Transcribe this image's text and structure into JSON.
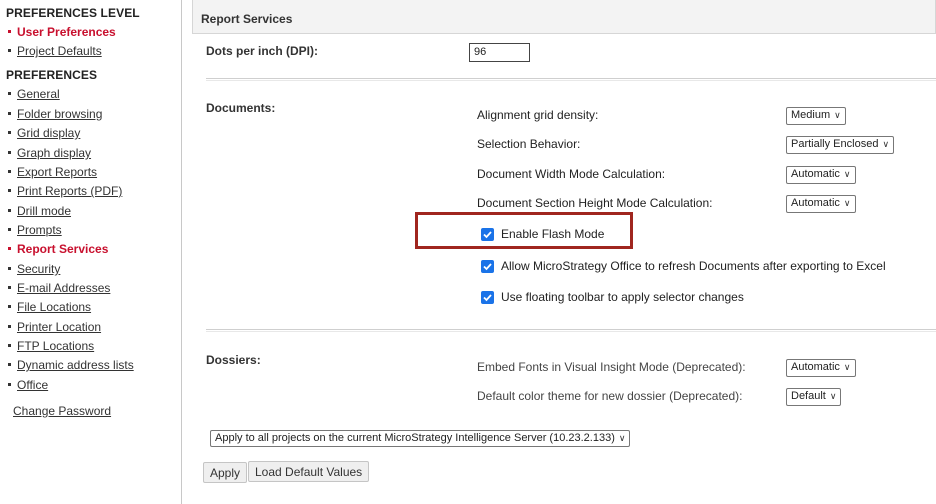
{
  "sidebar": {
    "section1_title": "PREFERENCES LEVEL",
    "level_items": [
      {
        "label": "User Preferences",
        "active": true
      },
      {
        "label": "Project Defaults",
        "active": false
      }
    ],
    "section2_title": "PREFERENCES",
    "items": [
      {
        "label": "General"
      },
      {
        "label": "Folder browsing"
      },
      {
        "label": "Grid display"
      },
      {
        "label": "Graph display"
      },
      {
        "label": "Export Reports"
      },
      {
        "label": "Print Reports (PDF)"
      },
      {
        "label": "Drill mode"
      },
      {
        "label": "Prompts"
      },
      {
        "label": "Report Services"
      },
      {
        "label": "Security"
      },
      {
        "label": "E-mail Addresses"
      },
      {
        "label": "File Locations"
      },
      {
        "label": "Printer Location"
      },
      {
        "label": "FTP Locations"
      },
      {
        "label": "Dynamic address lists"
      },
      {
        "label": "Office"
      }
    ],
    "active_item": "Report Services",
    "change_password": "Change Password"
  },
  "main": {
    "panel_title": "Report Services",
    "dpi": {
      "label": "Dots per inch (DPI):",
      "value": "96"
    },
    "documents": {
      "label": "Documents:",
      "alignment_grid": {
        "label": "Alignment grid density:",
        "value": "Medium"
      },
      "selection_behavior": {
        "label": "Selection Behavior:",
        "value": "Partially Enclosed"
      },
      "width_mode": {
        "label": "Document Width Mode Calculation:",
        "value": "Automatic"
      },
      "height_mode": {
        "label": "Document Section Height Mode Calculation:",
        "value": "Automatic"
      },
      "flash_mode": {
        "label": "Enable Flash Mode",
        "checked": true
      },
      "office_refresh": {
        "label": "Allow MicroStrategy Office to refresh Documents after exporting to Excel",
        "checked": true
      },
      "floating_toolbar": {
        "label": "Use floating toolbar to apply selector changes",
        "checked": true
      }
    },
    "dossiers": {
      "label": "Dossiers:",
      "embed_fonts": {
        "label": "Embed Fonts in Visual Insight Mode (Deprecated):",
        "value": "Automatic"
      },
      "color_theme": {
        "label": "Default color theme for new dossier (Deprecated):",
        "value": "Default"
      }
    },
    "apply_scope": "Apply to all projects on the current MicroStrategy Intelligence Server (10.23.2.133)",
    "apply_button": "Apply",
    "load_defaults_button": "Load Default Values"
  },
  "colors": {
    "active_nav": "#c8102e",
    "highlight_border": "#a0261f",
    "checkbox": "#1a73e8"
  }
}
